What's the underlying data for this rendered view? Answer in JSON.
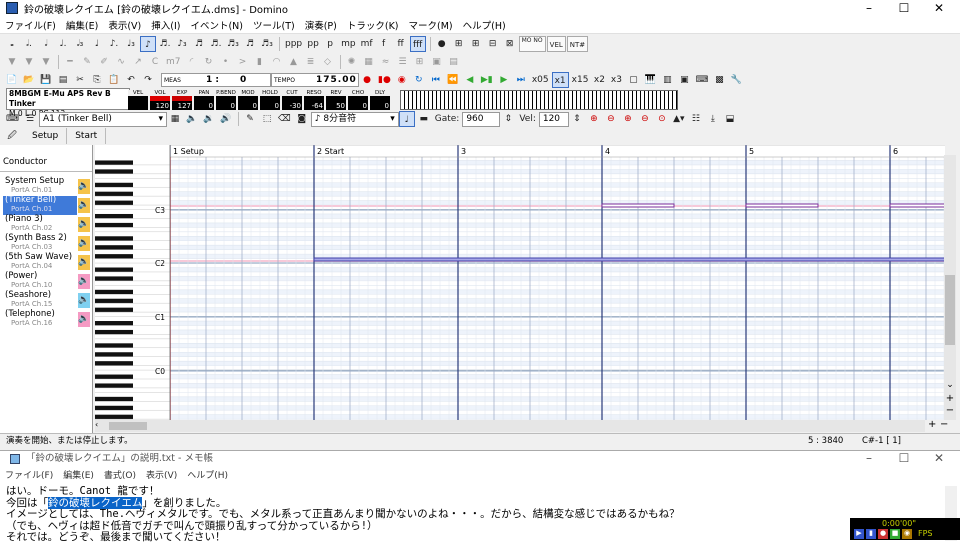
{
  "window": {
    "title": "鈴の破壊レクイエム [鈴の破壊レクイエム.dms] - Domino"
  },
  "menu": [
    "ファイル(F)",
    "編集(E)",
    "表示(V)",
    "挿入(I)",
    "イベント(N)",
    "ツール(T)",
    "演奏(P)",
    "トラック(K)",
    "マーク(M)",
    "ヘルプ(H)"
  ],
  "toolbar1": {
    "dynamics": [
      "ppp",
      "pp",
      "p",
      "mp",
      "mf",
      "f",
      "ff",
      "fff"
    ],
    "mono": "MO NO",
    "vel": "VEL",
    "nt": "NT#"
  },
  "transport": {
    "meas_label": "MEAS",
    "meas_value": "1 :",
    "tick_value": "0",
    "tempo_label": "TEMPO",
    "tempo_value": "175.00",
    "speed_options": [
      "x05",
      "x1",
      "x15",
      "x2",
      "x3"
    ],
    "speed_selected": "x1"
  },
  "port_panel": {
    "line1": "8MBGM E-Mu APS Rev B Tinker",
    "line2": "M  0  L  0  PC 113"
  },
  "mixer": [
    {
      "label": "VEL",
      "value": ""
    },
    {
      "label": "VOL",
      "value": "120"
    },
    {
      "label": "EXP",
      "value": "127"
    },
    {
      "label": "PAN",
      "value": "0"
    },
    {
      "label": "P.BEND",
      "value": "0"
    },
    {
      "label": "MOD",
      "value": "0"
    },
    {
      "label": "HOLD",
      "value": "0"
    },
    {
      "label": "CUT",
      "value": "-30"
    },
    {
      "label": "RESO",
      "value": "-64"
    },
    {
      "label": "REV",
      "value": "50"
    },
    {
      "label": "CHO",
      "value": "0"
    },
    {
      "label": "DLY",
      "value": "0"
    }
  ],
  "toolbar4": {
    "track_select": "A1  (Tinker Bell)",
    "note_length": "8分音符",
    "gate_label": "Gate:",
    "gate_value": "960",
    "vel_label": "Vel:",
    "vel_value": "120"
  },
  "tabs": [
    "Setup",
    "Start"
  ],
  "tracks": {
    "conductor": "Conductor",
    "items": [
      {
        "name": "System Setup",
        "port": "PortA  Ch.01"
      },
      {
        "name": "(Tinker Bell)",
        "port": "PortA  Ch.01"
      },
      {
        "name": "(Piano 3)",
        "port": "PortA  Ch.02"
      },
      {
        "name": "(Synth Bass 2)",
        "port": "PortA  Ch.03"
      },
      {
        "name": "(5th Saw Wave)",
        "port": "PortA  Ch.04"
      },
      {
        "name": "(Power)",
        "port": "PortA  Ch.10"
      },
      {
        "name": "(Seashore)",
        "port": "PortA  Ch.15"
      },
      {
        "name": "(Telephone)",
        "port": "PortA  Ch.16"
      }
    ]
  },
  "roll": {
    "measures": [
      "1 Setup",
      "2 Start",
      "3",
      "4",
      "5",
      "6"
    ],
    "octaves": [
      "C3",
      "C2",
      "C1",
      "C0"
    ]
  },
  "status": {
    "message": "演奏を開始、または停止します。",
    "position": "5 : 3840",
    "note": "C#-1 [ 1]"
  },
  "notepad": {
    "title": "「鈴の破壊レクイエム」の説明.txt - メモ帳",
    "menu": [
      "ファイル(F)",
      "編集(E)",
      "書式(O)",
      "表示(V)",
      "ヘルプ(H)"
    ],
    "line1": "はい。ドーモ。Canot 龍です！",
    "line2a": "今回は「",
    "line2hl": "鈴の破壊レクイエム",
    "line2b": "」を創りました。",
    "line3": "イメージとしては、The.ヘヴィメタルです。でも、メタル系って正直あんまり聞かないのよね・・・。だから、結構変な感じではあるかもね？",
    "line4": "（でも、ヘヴィは超ド低音でガチで叫んで頭振り乱すって分かっているから!）",
    "line5": "それでは。どうぞ、最後まで聞いてください！"
  },
  "recorder": {
    "time": "0:00'00\"",
    "fps": "FPS"
  }
}
